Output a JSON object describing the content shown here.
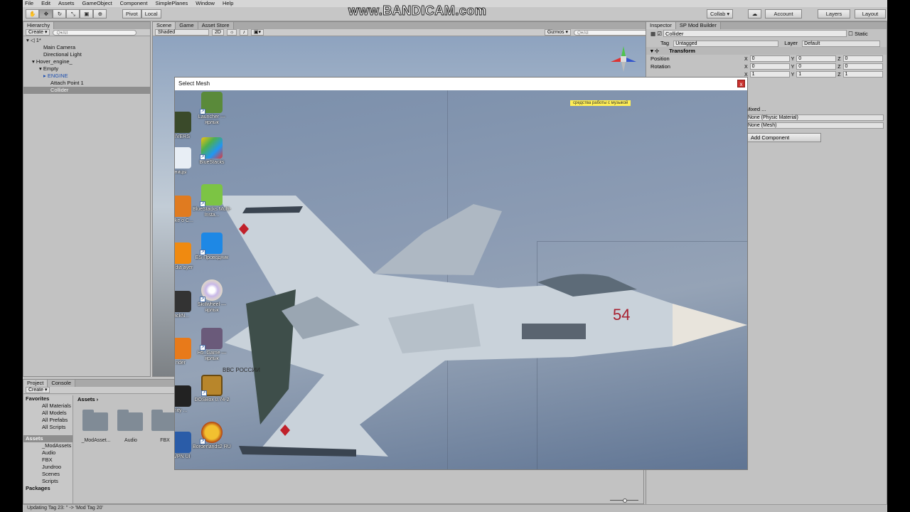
{
  "menubar": [
    "File",
    "Edit",
    "Assets",
    "GameObject",
    "Component",
    "SimplePlanes",
    "Window",
    "Help"
  ],
  "toolbar": {
    "pivot_label": "Pivot",
    "local_label": "Local",
    "collab_label": "Collab ▾",
    "account_label": "Account",
    "layers_label": "Layers",
    "layout_label": "Layout"
  },
  "watermark": "www.BANDICAM.com",
  "hierarchy": {
    "tab": "Hierarchy",
    "create_label": "Create ▾",
    "search_placeholder": "Q▾All",
    "scene_name": "1*",
    "items": [
      "Main Camera",
      "Directional Light",
      "Hover_engine_",
      "Empty",
      "ENGINE",
      "Attach Point 1",
      "Collider"
    ]
  },
  "scene": {
    "tabs": [
      "Scene",
      "Game",
      "Asset Store"
    ],
    "shaded_label": "Shaded",
    "mode_2d": "2D",
    "gizmos_label": "Gizmos ▾",
    "search_placeholder": "Q▾All"
  },
  "inspector": {
    "tabs": [
      "Inspector",
      "SP Mod Builder"
    ],
    "object_name": "Collider",
    "static_label": "Static",
    "tag_label": "Tag",
    "tag_value": "Untagged",
    "layer_label": "Layer",
    "layer_value": "Default",
    "transform_label": "Transform",
    "position_label": "Position",
    "rotation_label": "Rotation",
    "pos": {
      "x": "0",
      "y": "0",
      "z": "0"
    },
    "rot": {
      "x": "0",
      "y": "0",
      "z": "0"
    },
    "scale": {
      "x": "1",
      "y": "1",
      "z": "1"
    },
    "mixed_label": "Mixed ...",
    "physic_material": "None (Physic Material)",
    "mesh": "None (Mesh)",
    "add_component": "Add Component"
  },
  "project": {
    "tabs": [
      "Project",
      "Console"
    ],
    "create_label": "Create ▾",
    "favorites_label": "Favorites",
    "favorites": [
      "All Materials",
      "All Models",
      "All Prefabs",
      "All Scripts"
    ],
    "assets_label": "Assets",
    "assets_tree": [
      "_ModAssets",
      "Audio",
      "FBX",
      "Jundroo",
      "Scenes",
      "Scripts"
    ],
    "packages_label": "Packages",
    "breadcrumb": "Assets ›",
    "folders": [
      "_ModAsset...",
      "Audio",
      "FBX"
    ]
  },
  "status": "Updating Tag 23: '' -> 'Mod Tag 20'",
  "dialog": {
    "title": "Select Mesh",
    "close_label": "x",
    "note": "средства работы с музыкой",
    "desktop_left": [
      "DIVERS",
      "ницы",
      "make o C...",
      "media ayer",
      "rackN...",
      "nder",
      "nity ...",
      "nVPN UI"
    ],
    "desktop_icons": [
      {
        "label": "Launcher — ярлык",
        "color": "#5a8a3a"
      },
      {
        "label": "BlueStacks",
        "color": "#4caf50"
      },
      {
        "label": "BlueStacks Multi-Insta...",
        "color": "#7cc444"
      },
      {
        "label": "ES Проводник",
        "color": "#1e88e5"
      },
      {
        "label": "Skillwheel — ярлык",
        "color": "#e0d8c8"
      },
      {
        "label": "H5_Game — ярлык",
        "color": "#6a5a7a"
      },
      {
        "label": "DOSBox 0.74-2",
        "color": "#b8862b"
      },
      {
        "label": "Borderlands2 RU",
        "color": "#d8a820"
      }
    ],
    "jet_number": "54",
    "jet_text": "ВВС РОССИИ"
  }
}
